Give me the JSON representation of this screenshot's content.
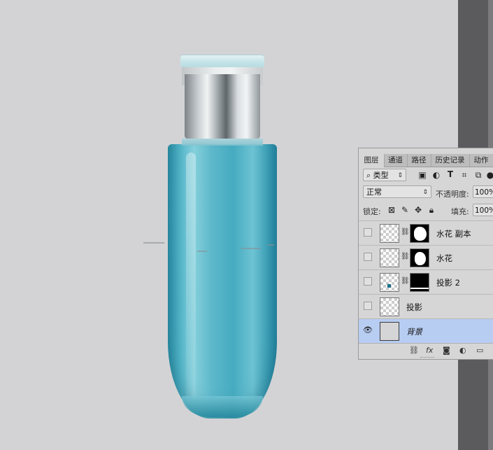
{
  "panel": {
    "tabs": [
      "图层",
      "通道",
      "路径",
      "历史记录",
      "动作"
    ],
    "filter": {
      "icon": "search-icon",
      "label": "类型"
    },
    "filter_tools": [
      "image-icon",
      "adjustment-circle-icon",
      "type-T-icon",
      "transform-icon",
      "smart-object-icon"
    ],
    "blend_mode": "正常",
    "opacity_label": "不透明度:",
    "opacity_value": "100%",
    "lock_label": "锁定:",
    "lock_tools": [
      "lock-transparent-icon",
      "brush-icon",
      "move-icon",
      "lock-icon"
    ],
    "fill_label": "填充:",
    "fill_value": "100%",
    "layers": [
      {
        "name": "水花 副本",
        "visible": false,
        "has_mask": true,
        "smart": true,
        "selected": false
      },
      {
        "name": "水花",
        "visible": false,
        "has_mask": true,
        "smart": true,
        "selected": false
      },
      {
        "name": "投影 2",
        "visible": false,
        "has_mask": true,
        "smart": false,
        "selected": false
      },
      {
        "name": "投影",
        "visible": false,
        "has_mask": false,
        "smart": false,
        "selected": false
      },
      {
        "name": "背景",
        "visible": true,
        "has_mask": false,
        "smart": false,
        "selected": true
      }
    ],
    "footer_icons": [
      "link-icon",
      "fx-icon",
      "add-mask-icon",
      "adjustment-icon",
      "new-group-folder-icon"
    ]
  },
  "glyphs": {
    "caret": "⇕",
    "eye": "👁",
    "link": "⛓",
    "fx": "fx"
  },
  "colors": {
    "canvas": "#d3d3d5",
    "selected_layer": "#b8cdf2",
    "bottle_accent": "#46abc0"
  }
}
